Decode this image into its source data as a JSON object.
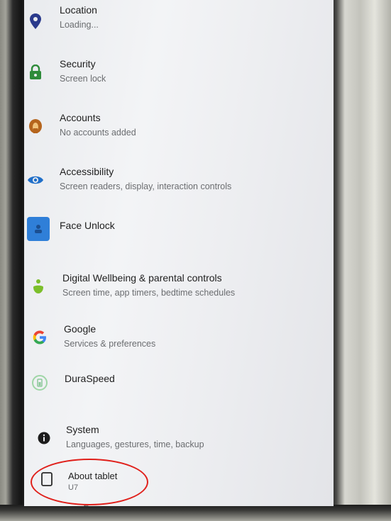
{
  "settings": {
    "items": [
      {
        "title": "Location",
        "summary": "Loading...",
        "icon": "location-pin-icon"
      },
      {
        "title": "Security",
        "summary": "Screen lock",
        "icon": "lock-icon"
      },
      {
        "title": "Accounts",
        "summary": "No accounts added",
        "icon": "account-icon"
      },
      {
        "title": "Accessibility",
        "summary": "Screen readers, display, interaction controls",
        "icon": "eye-icon"
      },
      {
        "title": "Face Unlock",
        "summary": "",
        "icon": "face-unlock-icon"
      },
      {
        "title": "Digital Wellbeing & parental controls",
        "summary": "Screen time, app timers, bedtime schedules",
        "icon": "wellbeing-icon"
      },
      {
        "title": "Google",
        "summary": "Services & preferences",
        "icon": "google-icon"
      },
      {
        "title": "DuraSpeed",
        "summary": "",
        "icon": "duraspeed-icon"
      },
      {
        "title": "System",
        "summary": "Languages, gestures, time, backup",
        "icon": "info-icon"
      },
      {
        "title": "About tablet",
        "summary": "U7",
        "icon": "tablet-icon"
      }
    ]
  },
  "colors": {
    "location": "#2a3a8c",
    "security": "#2e8b3a",
    "accounts": "#b5651d",
    "accessibility": "#1f6fc9",
    "face_unlock": "#2f7fd8",
    "wellbeing": "#7cbf2b",
    "annotation": "#e0201b"
  }
}
